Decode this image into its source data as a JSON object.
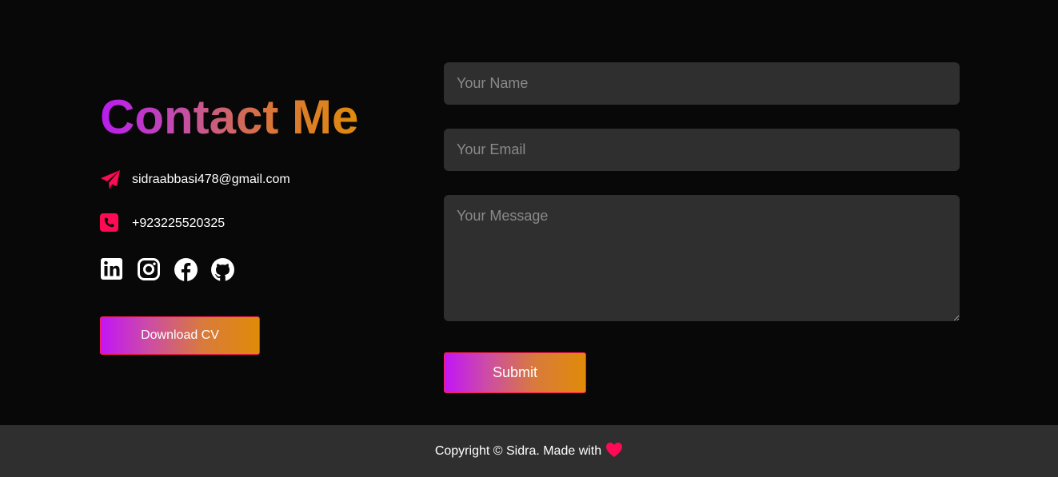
{
  "contact": {
    "title": "Contact Me",
    "email": "sidraabbasi478@gmail.com",
    "phone": "+923225520325",
    "email_icon": "paper-plane-icon",
    "phone_icon": "phone-square-icon",
    "socials": [
      "linkedin-icon",
      "instagram-icon",
      "facebook-icon",
      "github-icon"
    ],
    "download_label": "Download CV"
  },
  "form": {
    "name_placeholder": "Your Name",
    "email_placeholder": "Your Email",
    "message_placeholder": "Your Message",
    "submit_label": "Submit"
  },
  "footer": {
    "text": "Copyright © Sidra. Made with",
    "heart_icon": "heart-icon"
  },
  "colors": {
    "background": "#080808",
    "field": "#2f2f2f",
    "footer": "#2f2f2f",
    "accent_pink": "#ff0a54",
    "gradient_start": "#c215f7",
    "gradient_end": "#e08b08"
  }
}
